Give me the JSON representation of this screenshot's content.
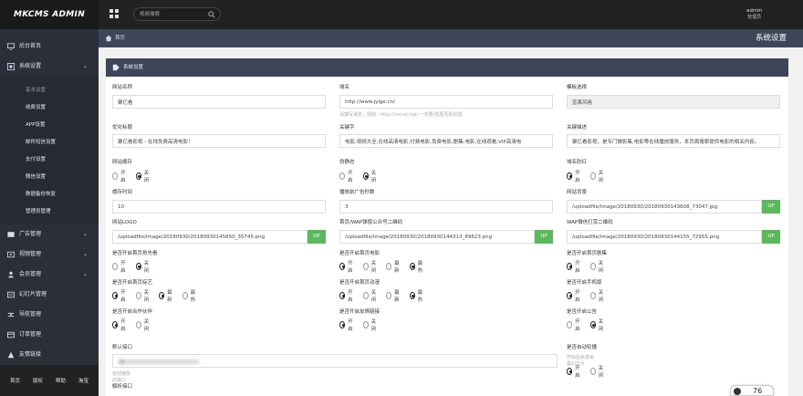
{
  "topbar": {
    "logo": "MKCMS ADMIN",
    "search_placeholder": "视频搜索",
    "user_name": "admin",
    "user_role": "管理员"
  },
  "sidebar": {
    "items_top": [
      {
        "label": "后台首页",
        "icon": "desktop-icon"
      },
      {
        "label": "系统设置",
        "icon": "settings-icon",
        "expanded": true
      }
    ],
    "sub_items": [
      {
        "label": "基本设置",
        "active": true
      },
      {
        "label": "收费设置"
      },
      {
        "label": "APP设置"
      },
      {
        "label": "邮件短信设置"
      },
      {
        "label": "支付设置"
      },
      {
        "label": "微信设置"
      },
      {
        "label": "数据备份恢复"
      },
      {
        "label": "管理员管理"
      }
    ],
    "items_bottom": [
      {
        "label": "广告管理",
        "icon": "ad-icon",
        "caret": true
      },
      {
        "label": "视频管理",
        "icon": "video-icon",
        "caret": true
      },
      {
        "label": "会员管理",
        "icon": "users-icon",
        "caret": true
      },
      {
        "label": "幻灯片管理",
        "icon": "slides-icon"
      },
      {
        "label": "导航管理",
        "icon": "nav-icon"
      },
      {
        "label": "订单管理",
        "icon": "order-icon"
      },
      {
        "label": "友情链接",
        "icon": "link-icon"
      }
    ],
    "footer": [
      "首页",
      "版权",
      "帮助",
      "淘宝"
    ]
  },
  "breadcrumb": {
    "home": "首页",
    "page_title": "系统设置"
  },
  "panel": {
    "title": "系统设置",
    "fields": {
      "site_name": {
        "label": "网站名称",
        "value": "聚亿看"
      },
      "domain": {
        "label": "域名",
        "value": "http://www.jyige.cn/",
        "hint": "请填写域名，例如：http://mccsl.top/ 一定要/结尾否则出错"
      },
      "template": {
        "label": "模板选择",
        "value": "蓝果风格"
      },
      "seo_title": {
        "label": "优化标题",
        "value": "聚亿看影视 - 在线免费高清电影！"
      },
      "keywords": {
        "label": "关键字",
        "value": "电影,视频大全,在线高清电影,付费电影,免费电影,剧集,电影,在线观看,VIP高清电"
      },
      "description": {
        "label": "关键描述",
        "value": "聚亿看影视，是专门做影集,电影等在线播放服务，本页面搜索提供电影的相关内容。"
      },
      "cache": {
        "label": "网站缓存",
        "options": [
          "开启",
          "关闭"
        ],
        "selected": 1
      },
      "pseudo_static": {
        "label": "伪静态",
        "options": [
          "开启",
          "关闭"
        ],
        "selected": 1
      },
      "anti_redirect": {
        "label": "域名防红",
        "options": [
          "开启",
          "关闭"
        ],
        "selected": 0
      },
      "cache_time": {
        "label": "缓存时间",
        "value": "10"
      },
      "pre_ad_seconds": {
        "label": "播放前广告秒数",
        "value": "3"
      },
      "site_bg": {
        "label": "网站背景",
        "value": "/uploadfile/image/20180930/20180930143608_73047.jpg",
        "button": "UP"
      },
      "site_logo": {
        "label": "网站LOGO",
        "value": "/uploadfile/image/20180930/20180930145650_35745.png",
        "button": "UP"
      },
      "wap_qr": {
        "label": "首页/WAP弹窗公众号二维码",
        "value": "/uploadfile/image/20180930/20180930144313_89623.png",
        "button": "UP"
      },
      "wap_reward_qr": {
        "label": "WAP微信打赏二维码",
        "value": "/uploadfile/image/20180930/20180930144155_72955.png",
        "button": "UP"
      },
      "home_first": {
        "label": "是否开启首页抢先看",
        "options": [
          "开启",
          "关闭"
        ],
        "selected": 1
      },
      "home_movie": {
        "label": "是否开启首页电影",
        "options": [
          "开启",
          "关闭",
          "最新",
          "最热"
        ],
        "selected": 0
      },
      "home_series": {
        "label": "是否开启首页剧集",
        "options": [
          "开启",
          "关闭"
        ],
        "selected": 0
      },
      "home_variety": {
        "label": "是否开启首页综艺",
        "options": [
          "开启",
          "关闭",
          "最新",
          "最热"
        ],
        "selected": 0,
        "selected2": 2
      },
      "home_anime": {
        "label": "是否开启首页动漫",
        "options": [
          "开启",
          "关闭",
          "最新",
          "最热"
        ],
        "selected": 0,
        "selected2": 3
      },
      "mobile": {
        "label": "是否开启手机版",
        "options": [
          "开启",
          "关闭"
        ],
        "selected": 0
      },
      "partners": {
        "label": "是否开启合作伙伴",
        "options": [
          "开启",
          "关闭"
        ],
        "selected": 0
      },
      "friend_links": {
        "label": "是否开启友情链接",
        "options": [
          "开启",
          "关闭"
        ],
        "selected": 0
      },
      "notice": {
        "label": "是否开启公告",
        "options": [
          "开启",
          "关闭"
        ],
        "selected": 1
      },
      "default_api": {
        "label": "默认接口",
        "hint": "自动播放的接口"
      },
      "autoplay": {
        "label": "是否自动轮播",
        "hint": "开启后会按采集幻灯片",
        "options": [
          "开启",
          "关闭"
        ],
        "selected": 0
      },
      "parse_api": {
        "label": "解析接口"
      }
    }
  },
  "speed_widget": {
    "value": "76"
  }
}
